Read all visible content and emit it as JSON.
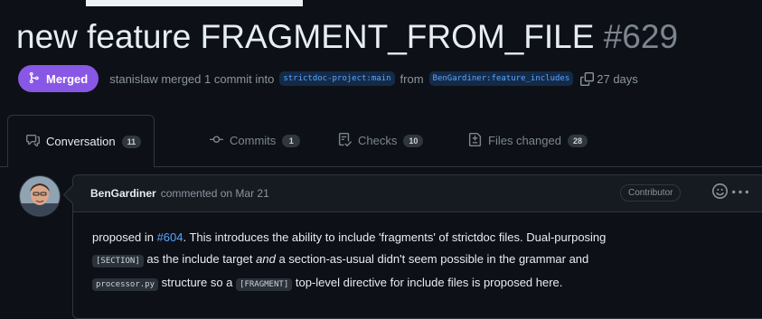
{
  "pr": {
    "title": "new feature FRAGMENT_FROM_FILE",
    "number": "#629",
    "status_label": "Merged",
    "merge_text_prefix": "stanislaw merged 1 commit into",
    "base_branch": "strictdoc-project:main",
    "from_text": "from",
    "head_branch": "BenGardiner:feature_includes",
    "age": "27 days"
  },
  "tabs": [
    {
      "label": "Conversation",
      "count": "11"
    },
    {
      "label": "Commits",
      "count": "1"
    },
    {
      "label": "Checks",
      "count": "10"
    },
    {
      "label": "Files changed",
      "count": "28"
    }
  ],
  "comment": {
    "author": "BenGardiner",
    "meta": "commented on Mar 21",
    "role": "Contributor",
    "line1_prefix": "proposed in",
    "line1_link": "#604",
    "line1_rest": ". This introduces the ability to include 'fragments' of strictdoc files. Dual-purposing",
    "line2_code": "[SECTION]",
    "line2_a": "as the include target",
    "line2_em": "and",
    "line2_b": "a section-as-usual didn't seem possible in the grammar and",
    "line3_code1": "processor.py",
    "line3_a": "structure so a",
    "line3_code2": "[FRAGMENT]",
    "line3_b": "top-level directive for include files is proposed here."
  },
  "colors": {
    "background": "#0d1117",
    "merged_badge": "#8957e5",
    "link": "#58a6ff"
  },
  "icons": {
    "merged": "git-merge-icon",
    "copy": "copy-icon",
    "conversation": "comment-discussion-icon",
    "commits": "git-commit-icon",
    "checks": "checklist-icon",
    "files": "file-diff-icon",
    "emoji": "smiley-icon",
    "more": "kebab-horizontal-icon"
  }
}
